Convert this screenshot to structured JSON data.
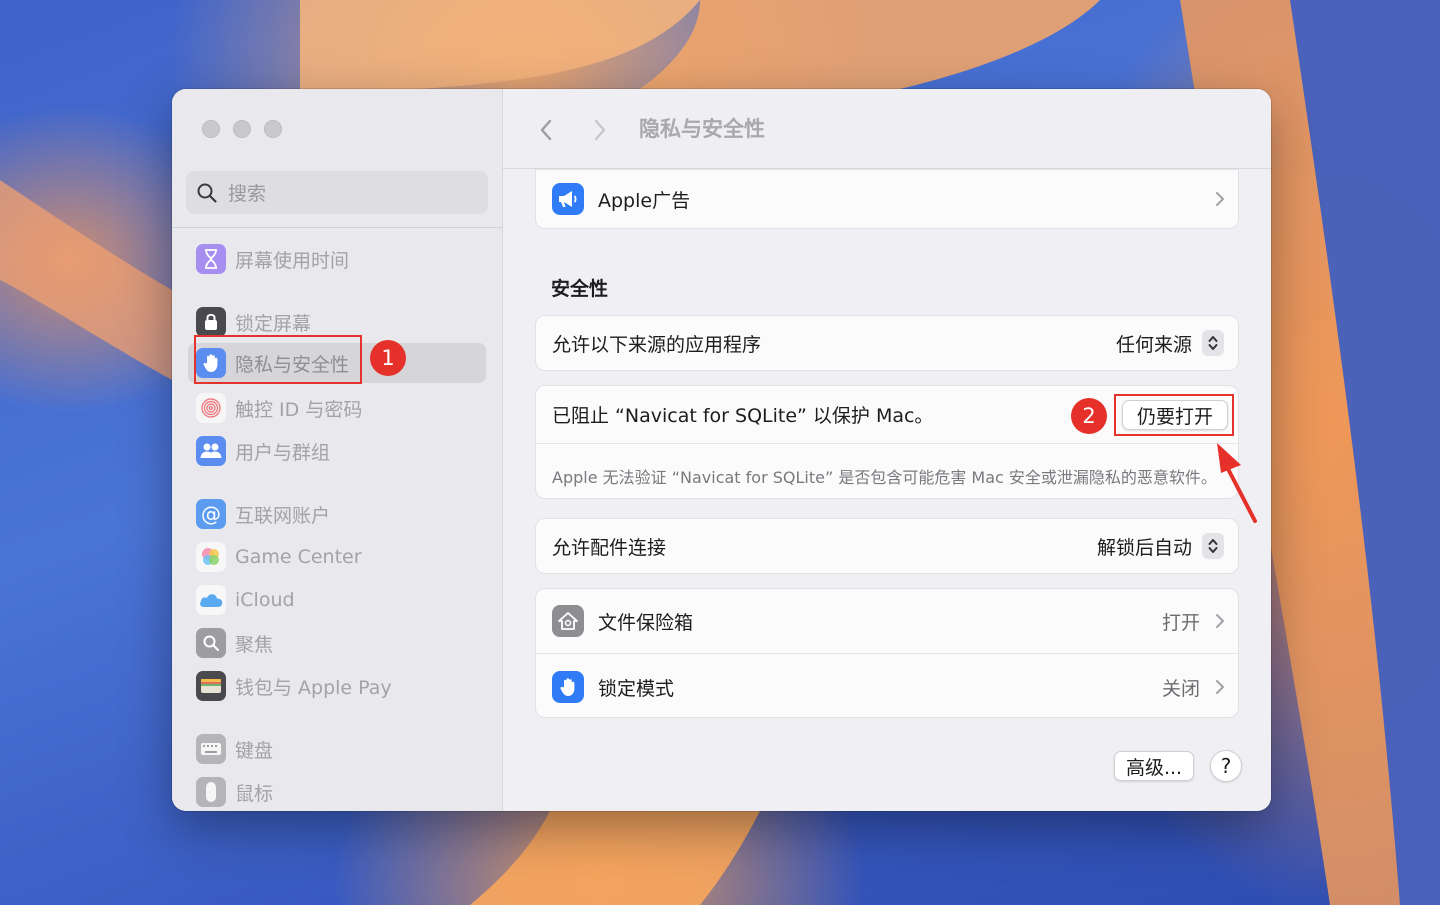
{
  "window": {
    "title": "隐私与安全性"
  },
  "search": {
    "placeholder": "搜索"
  },
  "sidebar": {
    "items": [
      {
        "label": "屏幕使用时间",
        "icon": "hourglass-icon"
      },
      {
        "label": "锁定屏幕",
        "icon": "lock-icon"
      },
      {
        "label": "隐私与安全性",
        "icon": "hand-icon",
        "selected": true
      },
      {
        "label": "触控 ID 与密码",
        "icon": "fingerprint-icon"
      },
      {
        "label": "用户与群组",
        "icon": "users-icon"
      },
      {
        "label": "互联网账户",
        "icon": "at-icon"
      },
      {
        "label": "Game Center",
        "icon": "game-center-icon"
      },
      {
        "label": "iCloud",
        "icon": "cloud-icon"
      },
      {
        "label": "聚焦",
        "icon": "magnifier-icon"
      },
      {
        "label": "钱包与 Apple Pay",
        "icon": "wallet-icon"
      },
      {
        "label": "键盘",
        "icon": "keyboard-icon"
      },
      {
        "label": "鼠标",
        "icon": "mouse-icon"
      }
    ]
  },
  "main": {
    "apple_ads": {
      "label": "Apple广告"
    },
    "security_title": "安全性",
    "allow_apps": {
      "label": "允许以下来源的应用程序",
      "value": "任何来源"
    },
    "blocked": {
      "message": "已阻止 “Navicat for SQLite” 以保护 Mac。",
      "button": "仍要打开",
      "detail": "Apple 无法验证 “Navicat for SQLite” 是否包含可能危害 Mac 安全或泄漏隐私的恶意软件。"
    },
    "accessories": {
      "label": "允许配件连接",
      "value": "解锁后自动"
    },
    "filevault": {
      "label": "文件保险箱",
      "value": "打开"
    },
    "lockdown": {
      "label": "锁定模式",
      "value": "关闭"
    },
    "advanced_button": "高级...",
    "help_button": "?"
  },
  "annotations": {
    "badge1": "1",
    "badge2": "2",
    "accent": "#e5312a"
  }
}
